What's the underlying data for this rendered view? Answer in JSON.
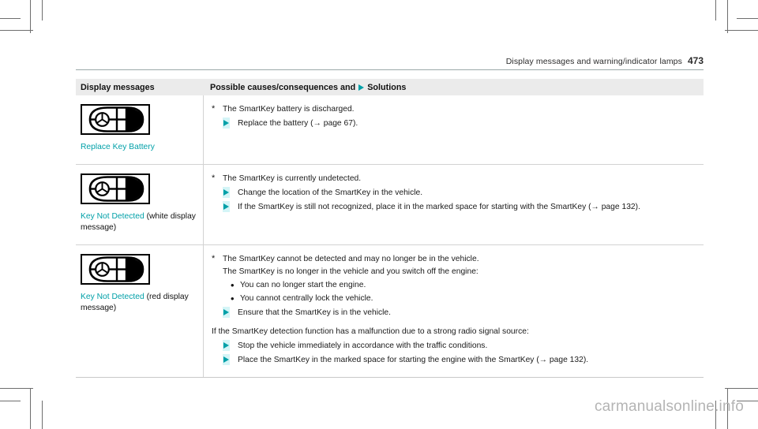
{
  "header": {
    "title": "Display messages and warning/indicator lamps",
    "page_number": "473"
  },
  "colors": {
    "accent_teal": "#00a0a8",
    "highlight_cyan": "#d4f5f7",
    "header_row_bg": "#ebebeb",
    "rule_gray": "#d2d2d2",
    "watermark_gray": "#b4b4b4"
  },
  "table": {
    "columns": [
      {
        "label": "Display messages"
      },
      {
        "label_before_icon": "Possible causes/consequences and",
        "icon": "solution-triangle-icon",
        "label_after_icon": "Solutions"
      }
    ],
    "rows": [
      {
        "icon_name": "smartkey-fob-icon",
        "message_name": "Replace Key Battery",
        "message_suffix": "",
        "content": [
          {
            "kind": "cause",
            "marker": "*",
            "text": "The SmartKey battery is discharged."
          },
          {
            "kind": "action",
            "text": "Replace the battery (→ page 67)."
          }
        ]
      },
      {
        "icon_name": "smartkey-fob-icon",
        "message_name": "Key Not Detected",
        "message_suffix": " (white display message)",
        "content": [
          {
            "kind": "cause",
            "marker": "*",
            "text": "The SmartKey is currently undetected."
          },
          {
            "kind": "action",
            "text": "Change the location of the SmartKey in the vehicle."
          },
          {
            "kind": "action",
            "text": "If the SmartKey is still not recognized, place it in the marked space for starting with the SmartKey (→ page 132)."
          }
        ]
      },
      {
        "icon_name": "smartkey-fob-icon",
        "message_name": "Key Not Detected",
        "message_suffix": " (red display message)",
        "content": [
          {
            "kind": "cause",
            "marker": "*",
            "text": "The SmartKey cannot be detected and may no longer be in the vehicle."
          },
          {
            "kind": "plain",
            "text": "The SmartKey is no longer in the vehicle and you switch off the engine:"
          },
          {
            "kind": "dot",
            "text": "You can no longer start the engine."
          },
          {
            "kind": "dot",
            "text": "You cannot centrally lock the vehicle."
          },
          {
            "kind": "action",
            "text": "Ensure that the SmartKey is in the vehicle."
          },
          {
            "kind": "plain_flush",
            "text": "If the SmartKey detection function has a malfunction due to a strong radio signal source:"
          },
          {
            "kind": "action",
            "text": "Stop the vehicle immediately in accordance with the traffic conditions."
          },
          {
            "kind": "action",
            "text": "Place the SmartKey in the marked space for starting the engine with the SmartKey (→ page 132)."
          }
        ]
      }
    ]
  },
  "watermark": {
    "text": "carmanualsonline.info"
  }
}
